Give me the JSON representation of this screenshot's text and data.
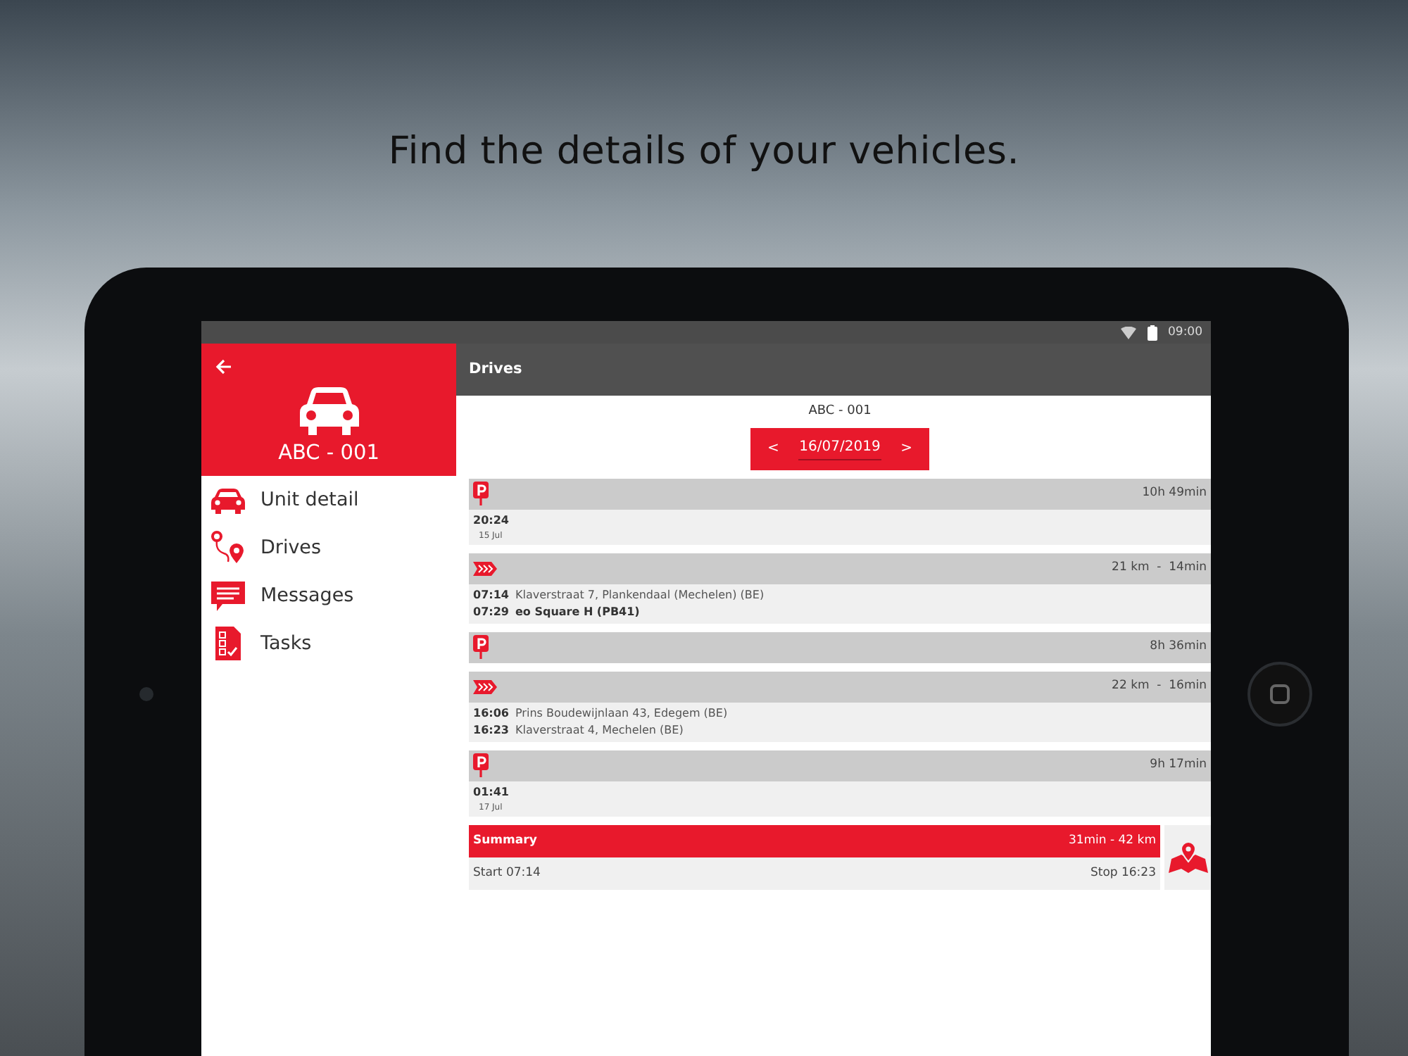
{
  "headline": "Find the details of your vehicles.",
  "status_bar": {
    "time": "09:00"
  },
  "sidebar": {
    "unit": "ABC - 001",
    "items": [
      {
        "label": "Unit detail",
        "kind": "car"
      },
      {
        "label": "Drives",
        "kind": "route"
      },
      {
        "label": "Messages",
        "kind": "message"
      },
      {
        "label": "Tasks",
        "kind": "tasks"
      }
    ]
  },
  "app_bar": {
    "title": "Drives"
  },
  "date_picker": {
    "unit": "ABC - 001",
    "prev": "<",
    "date": "16/07/2019",
    "next": ">"
  },
  "entries": [
    {
      "kind": "parking",
      "duration": "10h 49min",
      "time": "20:24",
      "date": "15 Jul"
    },
    {
      "kind": "drive",
      "duration": "21 km  -  14min",
      "stops": [
        {
          "time": "07:14",
          "address": "Klaverstraat 7, Plankendaal (Mechelen) (BE)",
          "bold": false
        },
        {
          "time": "07:29",
          "address": "eo Square H (PB41)",
          "bold": true
        }
      ]
    },
    {
      "kind": "parking",
      "duration": "8h 36min"
    },
    {
      "kind": "drive",
      "duration": "22 km  -  16min",
      "stops": [
        {
          "time": "16:06",
          "address": "Prins Boudewijnlaan 43, Edegem (BE)",
          "bold": false
        },
        {
          "time": "16:23",
          "address": "Klaverstraat 4, Mechelen (BE)",
          "bold": false
        }
      ]
    },
    {
      "kind": "parking",
      "duration": "9h 17min",
      "time": "01:41",
      "date": "17 Jul"
    }
  ],
  "summary": {
    "title": "Summary",
    "totals": "31min  -  42 km",
    "start": "Start  07:14",
    "stop": "Stop  16:23"
  }
}
